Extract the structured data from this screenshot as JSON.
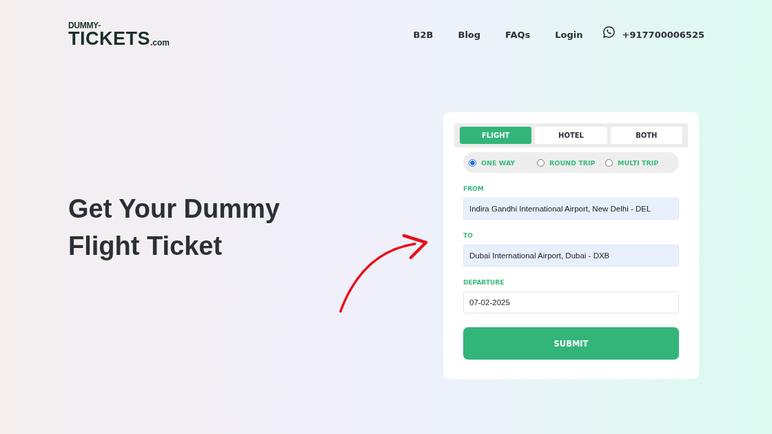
{
  "logo": {
    "top": "DUMMY-",
    "main": "TICKETS",
    "suffix": ".com"
  },
  "nav": [
    "B2B",
    "Blog",
    "FAQs",
    "Login"
  ],
  "phone": "+917700006525",
  "hero": {
    "lines": [
      "Get Your Dummy",
      "Flight Ticket"
    ]
  },
  "form": {
    "tabs": [
      {
        "label": "FLIGHT",
        "selected": true
      },
      {
        "label": "HOTEL",
        "selected": false
      },
      {
        "label": "BOTH",
        "selected": false
      }
    ],
    "trip_types": [
      {
        "label": "ONE WAY",
        "selected": true
      },
      {
        "label": "ROUND TRIP",
        "selected": false
      },
      {
        "label": "MULTI TRIP",
        "selected": false
      }
    ],
    "fields": [
      {
        "label": "FROM",
        "value": "Indira Gandhi International Airport, New Delhi - DEL",
        "autofilled": true
      },
      {
        "label": "TO",
        "value": "Dubai International Airport, Dubai - DXB",
        "autofilled": true
      },
      {
        "label": "DEPARTURE",
        "value": "07-02-2025",
        "autofilled": false
      }
    ],
    "submit": "SUBMIT"
  }
}
